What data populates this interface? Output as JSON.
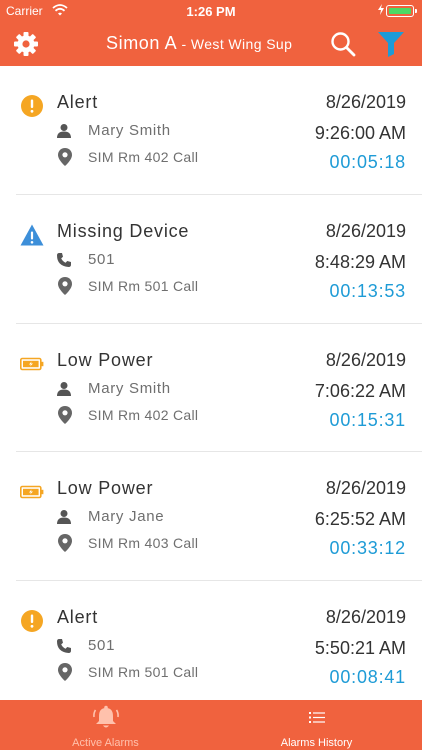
{
  "status_bar": {
    "carrier": "Carrier",
    "time": "1:26 PM"
  },
  "header": {
    "title": "Simon A",
    "subtitle": " - West Wing Sup",
    "icons": [
      "gear-icon",
      "search-icon",
      "filter-icon"
    ]
  },
  "colors": {
    "accent": "#f0623e",
    "duration": "#1e9bd6",
    "alert": "#f5a623",
    "info": "#3d8fd9",
    "power": "#f5a623"
  },
  "alarms": [
    {
      "type": "Alert",
      "icon": "alert-icon",
      "line1_icon": "person-icon",
      "line1": "Mary Smith",
      "location": "SIM Rm 402 Call",
      "date": "8/26/2019",
      "time": "9:26:00 AM",
      "duration": "00:05:18"
    },
    {
      "type": "Missing Device",
      "icon": "warning-icon",
      "line1_icon": "phone-icon",
      "line1": "501",
      "location": "SIM Rm 501 Call",
      "date": "8/26/2019",
      "time": "8:48:29 AM",
      "duration": "00:13:53"
    },
    {
      "type": "Low Power",
      "icon": "battery-icon",
      "line1_icon": "person-icon",
      "line1": "Mary Smith",
      "location": "SIM Rm 402 Call",
      "date": "8/26/2019",
      "time": "7:06:22 AM",
      "duration": "00:15:31"
    },
    {
      "type": "Low Power",
      "icon": "battery-icon",
      "line1_icon": "person-icon",
      "line1": "Mary Jane",
      "location": "SIM Rm 403 Call",
      "date": "8/26/2019",
      "time": "6:25:52 AM",
      "duration": "00:33:12"
    },
    {
      "type": "Alert",
      "icon": "alert-icon",
      "line1_icon": "phone-icon",
      "line1": "501",
      "location": "SIM Rm 501 Call",
      "date": "8/26/2019",
      "time": "5:50:21 AM",
      "duration": "00:08:41"
    }
  ],
  "tabs": [
    {
      "label": "Active Alarms",
      "icon": "bell-icon",
      "selected": true
    },
    {
      "label": "Alarms History",
      "icon": "list-icon",
      "selected": false
    }
  ]
}
